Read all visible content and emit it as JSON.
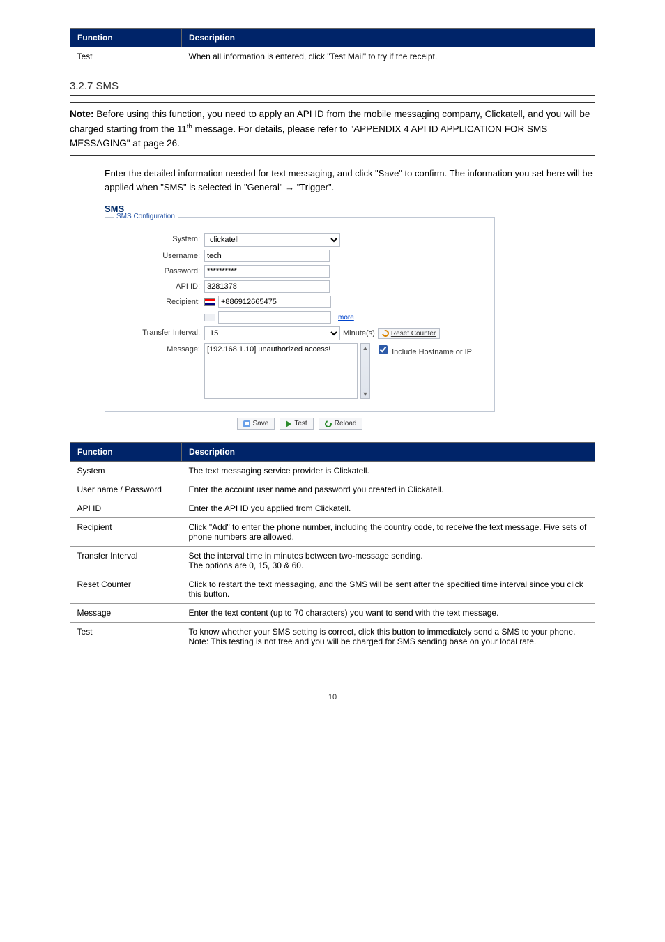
{
  "topTable": {
    "head": {
      "func": "Function",
      "desc": "Description"
    },
    "rows": [
      {
        "func": "Test",
        "desc": "When all information is entered, click \"Test Mail\" to try if the receipt."
      }
    ]
  },
  "section": {
    "num": "3.2.7 SMS"
  },
  "note": {
    "label": "Note:",
    "text1": "Before using this function, you need to apply an API ID from the mobile messaging company, Clickatell, and you will be charged starting from the 11",
    "sup": "th",
    "text2": " message. For details, please refer to \"APPENDIX 4 API ID APPLICATION FOR SMS MESSAGING\" at page 26."
  },
  "intro": "Enter the detailed information needed for text messaging, and click \"Save\" to confirm. The information you set here will be applied when \"SMS\" is selected in \"General\"  →  \"Trigger\".",
  "sms": {
    "title": "SMS",
    "legend": "SMS Configuration",
    "labels": {
      "system": "System:",
      "username": "Username:",
      "password": "Password:",
      "apiid": "API ID:",
      "recipient": "Recipient:",
      "interval": "Transfer Interval:",
      "message": "Message:"
    },
    "values": {
      "system": "clickatell",
      "username": "tech",
      "password": "**********",
      "apiid": "3281378",
      "recipient": "+886912665475",
      "interval": "15",
      "message": "[192.168.1.10] unauthorized access!"
    },
    "more": "more",
    "minuteUnit": "Minute(s)",
    "reset": "Reset Counter",
    "includeHost": "Include Hostname or IP",
    "buttons": {
      "save": "Save",
      "test": "Test",
      "reload": "Reload"
    }
  },
  "paramsTable": {
    "head": {
      "func": "Function",
      "desc": "Description"
    },
    "rows": [
      {
        "func": "System",
        "desc": "The text messaging service provider is Clickatell."
      },
      {
        "func": "User name / Password",
        "desc": "Enter the account user name and password you created in Clickatell."
      },
      {
        "func": "API ID",
        "desc": "Enter the API ID you applied from Clickatell."
      },
      {
        "func": "Recipient",
        "desc": "Click \"Add\" to enter the phone number, including the country code, to receive the text message. Five sets of phone numbers are allowed."
      },
      {
        "func": "Transfer Interval",
        "desc": "Set the interval time in minutes between two-message sending.\nThe options are 0, 15, 30 & 60."
      },
      {
        "func": "Reset Counter",
        "desc": "Click to restart the text messaging, and the SMS will be sent after the specified time interval since you click this button."
      },
      {
        "func": "Message",
        "desc": "Enter the text content (up to 70 characters) you want to send with the text message."
      },
      {
        "func": "Test",
        "desc": "To know whether your SMS setting is correct, click this button to immediately send a SMS to your phone.\nNote: This testing is not free and you will be charged for SMS sending base on your local rate."
      }
    ]
  },
  "pageNumber": "10"
}
